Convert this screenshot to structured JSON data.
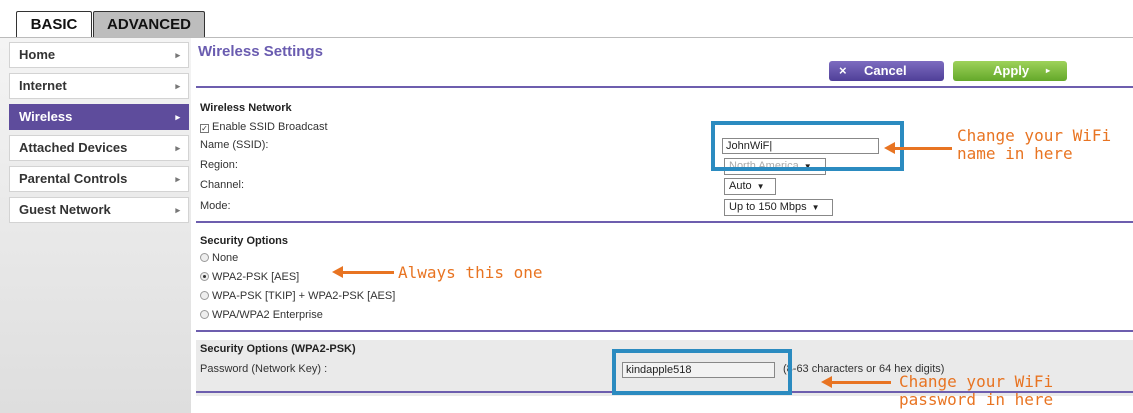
{
  "tabs": {
    "basic": "BASIC",
    "advanced": "ADVANCED"
  },
  "sidebar": {
    "items": [
      {
        "label": "Home"
      },
      {
        "label": "Internet"
      },
      {
        "label": "Wireless"
      },
      {
        "label": "Attached Devices"
      },
      {
        "label": "Parental Controls"
      },
      {
        "label": "Guest Network"
      }
    ],
    "arrow": "▸"
  },
  "header": {
    "title": "Wireless Settings",
    "cancel_label": "Cancel",
    "cancel_icon": "×",
    "apply_label": "Apply",
    "apply_icon": "▸"
  },
  "wireless": {
    "title": "Wireless Network",
    "enable_ssid": "Enable SSID Broadcast",
    "name_label": "Name (SSID):",
    "name_value": "JohnWiF|",
    "region_label": "Region:",
    "region_value": "North America",
    "channel_label": "Channel:",
    "channel_value": "Auto",
    "mode_label": "Mode:",
    "mode_value": "Up to 150 Mbps"
  },
  "security": {
    "title": "Security Options",
    "options": [
      "None",
      "WPA2-PSK [AES]",
      "WPA-PSK [TKIP] + WPA2-PSK [AES]",
      "WPA/WPA2 Enterprise"
    ],
    "selected_index": 1
  },
  "wpa2": {
    "title": "Security Options (WPA2-PSK)",
    "password_label": "Password (Network Key) :",
    "password_value": "kindapple518",
    "hint": "(8-63 characters or 64 hex digits)"
  },
  "annotations": {
    "ssid_note_line1": "Change your WiFi",
    "ssid_note_line2": "name in here",
    "security_note": "Always this one",
    "password_note_line1": "Change your WiFi",
    "password_note_line2": "password in here",
    "color": "#e87422",
    "box_color": "#2b8bc0"
  },
  "colors": {
    "accent": "#6a5cb0",
    "apply": "#7cbf3a",
    "cancel": "#5e4c9c"
  }
}
